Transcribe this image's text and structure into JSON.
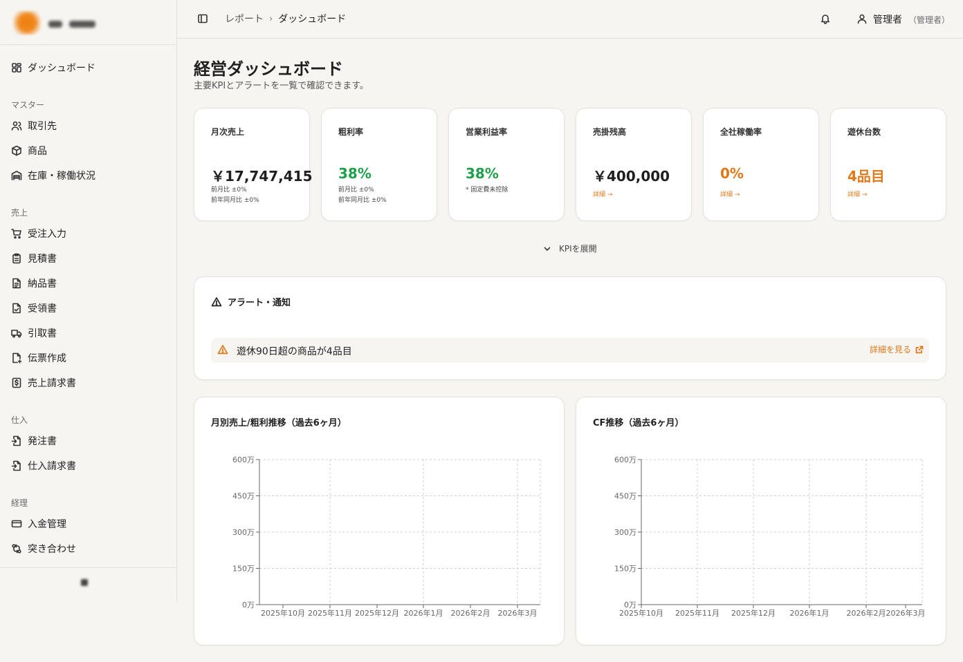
{
  "sidebar": {
    "top_item": "ダッシュボード",
    "sections": [
      {
        "label": "マスター",
        "items": [
          "取引先",
          "商品",
          "在庫・稼働状況"
        ]
      },
      {
        "label": "売上",
        "items": [
          "受注入力",
          "見積書",
          "納品書",
          "受領書",
          "引取書",
          "伝票作成",
          "売上請求書"
        ]
      },
      {
        "label": "仕入",
        "items": [
          "発注書",
          "仕入請求書"
        ]
      },
      {
        "label": "経理",
        "items": [
          "入金管理",
          "突き合わせ"
        ]
      }
    ]
  },
  "header": {
    "breadcrumb_parent": "レポート",
    "breadcrumb_separator": "›",
    "breadcrumb_current": "ダッシュボード",
    "user_name": "管理者",
    "user_role": "（管理者）"
  },
  "page": {
    "title": "経営ダッシュボード",
    "subtitle": "主要KPIとアラートを一覧で確認できます。"
  },
  "kpis": [
    {
      "label": "月次売上",
      "value": "￥17,747,415",
      "sub1": "前月比 ±0%",
      "sub2": "前年同月比 ±0%"
    },
    {
      "label": "粗利率",
      "value": "38%",
      "sub1": "前月比 ±0%",
      "sub2": "前年同月比 ±0%"
    },
    {
      "label": "営業利益率",
      "value": "38%",
      "sub1": "* 固定費未控除"
    },
    {
      "label": "売掛残高",
      "value": "￥400,000",
      "link": "詳細 →"
    },
    {
      "label": "全社稼働率",
      "value": "0%",
      "link": "詳細 →"
    },
    {
      "label": "遊休台数",
      "value": "4品目",
      "link": "詳細 →"
    }
  ],
  "expand_label": "KPIを展開",
  "alerts": {
    "title": "アラート・通知",
    "items": [
      {
        "text": "遊休90日超の商品が4品目",
        "link": "詳細を見る"
      }
    ]
  },
  "colors": {
    "accent": "#e0781a",
    "positive": "#1ea04a"
  },
  "charts": {
    "left_title": "月別売上/粗利推移（過去6ヶ月）",
    "right_title": "CF推移（過去6ヶ月）"
  },
  "chart_data": [
    {
      "type": "bar",
      "title": "月別売上/粗利推移（過去6ヶ月）",
      "categories": [
        "2025年10月",
        "2025年11月",
        "2025年12月",
        "2026年1月",
        "2026年2月",
        "2026年3月"
      ],
      "y_ticks": [
        "0万",
        "150万",
        "300万",
        "450万",
        "600万"
      ],
      "ylim": [
        0,
        600
      ],
      "series": [],
      "grid": true
    },
    {
      "type": "line",
      "title": "CF推移（過去6ヶ月）",
      "categories": [
        "2025年10月",
        "2025年11月",
        "2025年12月",
        "2026年1月",
        "2026年2月",
        "2026年3月"
      ],
      "y_ticks": [
        "0万",
        "150万",
        "300万",
        "450万",
        "600万"
      ],
      "ylim": [
        0,
        600
      ],
      "series": [],
      "grid": true
    }
  ]
}
